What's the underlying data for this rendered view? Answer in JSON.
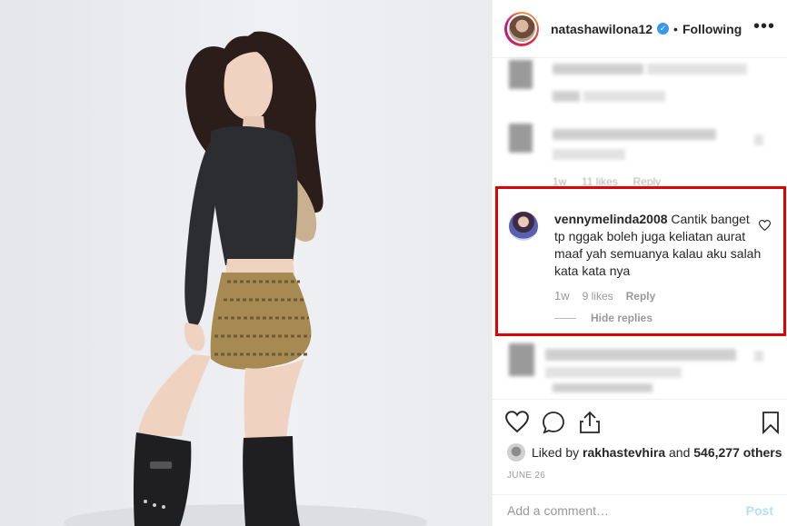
{
  "header": {
    "username": "natashawilona12",
    "separator": "•",
    "follow_status": "Following",
    "more_label": "•••"
  },
  "highlighted_comment": {
    "username": "vennymelinda2008",
    "text": "Cantik banget tp nggak boleh juga keliatan aurat maaf yah semuanya kalau aku salah kata kata nya",
    "time": "1w",
    "likes": "9 likes",
    "reply": "Reply",
    "hide_replies": "Hide replies"
  },
  "blurred_meta": {
    "time": "1w",
    "likes": "11 likes",
    "reply": "Reply"
  },
  "likes": {
    "prefix": "Liked by",
    "user": "rakhastevhira",
    "conj": "and",
    "count": "546,277 others"
  },
  "post_date": "JUNE 26",
  "add_comment": {
    "placeholder": "Add a comment…",
    "post_label": "Post"
  },
  "icons": [
    "heart-icon",
    "comment-icon",
    "share-icon",
    "bookmark-icon",
    "verified-icon",
    "more-icon"
  ],
  "colors": {
    "highlight_border": "#e00000",
    "verified": "#3897f0",
    "post_disabled": "#b2dffc"
  }
}
